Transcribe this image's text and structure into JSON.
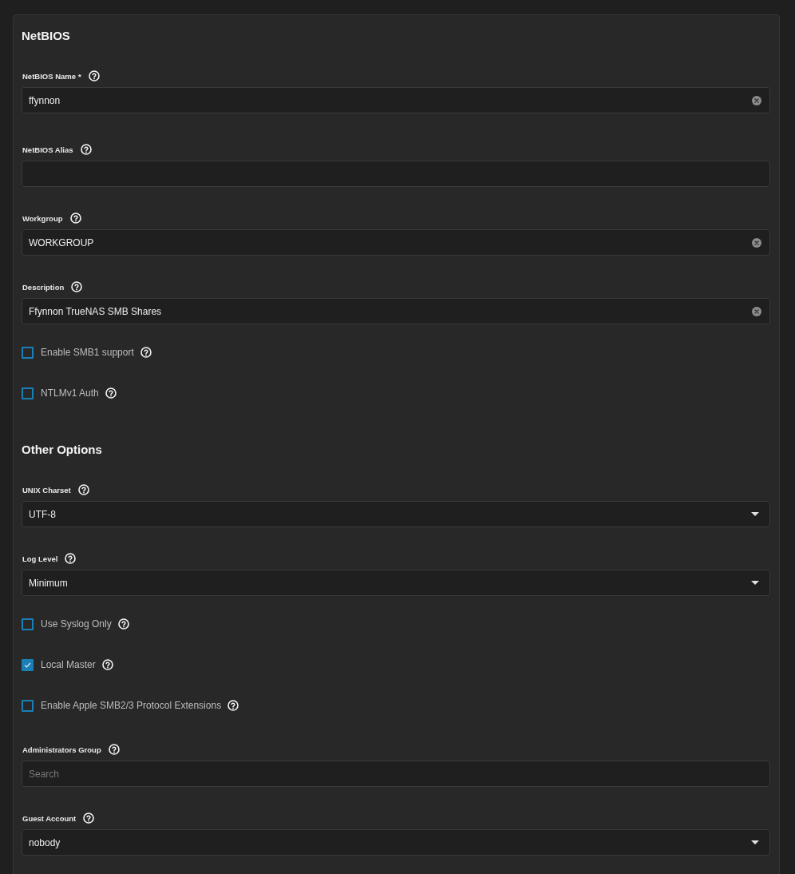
{
  "sections": [
    {
      "title": "NetBIOS",
      "items": [
        {
          "kind": "text",
          "label": "NetBIOS Name",
          "required_mark": "*",
          "value": "ffynnon",
          "clearable": true
        },
        {
          "kind": "text",
          "label": "NetBIOS Alias",
          "clearable": false
        },
        {
          "kind": "text",
          "label": "Workgroup",
          "value": "WORKGROUP",
          "clearable": true
        },
        {
          "kind": "text",
          "label": "Description",
          "value": "Ffynnon TrueNAS SMB Shares",
          "clearable": true
        },
        {
          "kind": "checkbox",
          "label": "Enable SMB1 support",
          "checked": false
        },
        {
          "kind": "checkbox",
          "label": "NTLMv1 Auth",
          "checked": false
        }
      ]
    },
    {
      "title": "Other Options",
      "items": [
        {
          "kind": "select",
          "label": "UNIX Charset",
          "value": "UTF-8"
        },
        {
          "kind": "select",
          "label": "Log Level",
          "value": "Minimum"
        },
        {
          "kind": "checkbox",
          "label": "Use Syslog Only",
          "checked": false
        },
        {
          "kind": "checkbox",
          "label": "Local Master",
          "checked": true
        },
        {
          "kind": "checkbox",
          "label": "Enable Apple SMB2/3 Protocol Extensions",
          "checked": false
        },
        {
          "kind": "text",
          "label": "Administrators Group",
          "placeholder": "Search",
          "clearable": false
        },
        {
          "kind": "select",
          "label": "Guest Account",
          "value": "nobody"
        }
      ]
    }
  ]
}
